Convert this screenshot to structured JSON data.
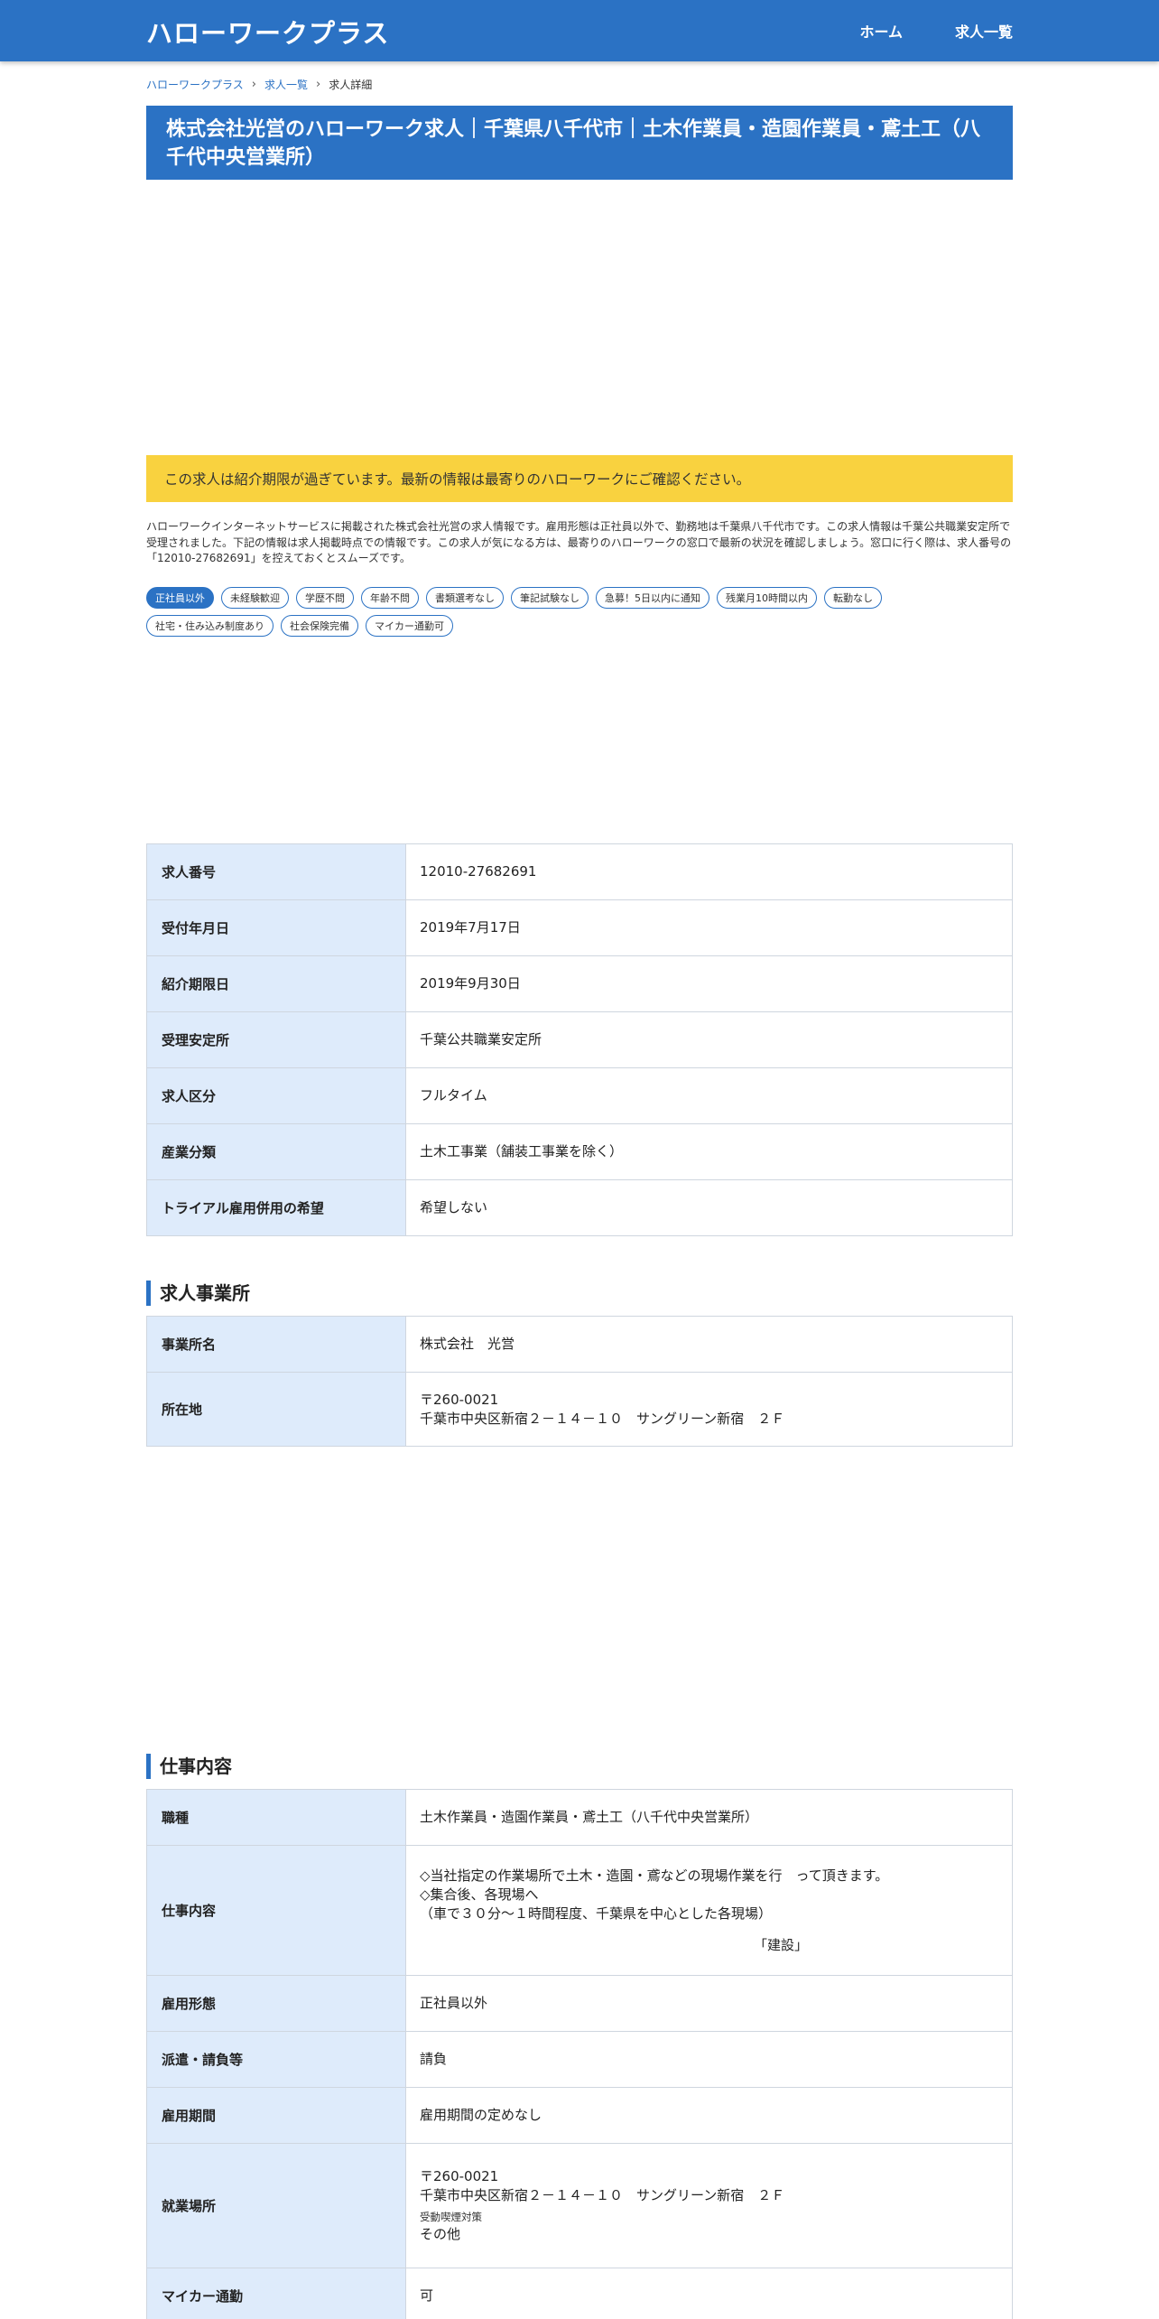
{
  "header": {
    "brand": "ハローワークプラス",
    "nav": [
      "ホーム",
      "求人一覧"
    ]
  },
  "breadcrumb": {
    "items": [
      "ハローワークプラス",
      "求人一覧"
    ],
    "current": "求人詳細"
  },
  "page_title": "株式会社光営のハローワーク求人｜千葉県八千代市｜土木作業員・造園作業員・鳶土工（八千代中央営業所）",
  "alert": "この求人は紹介期限が過ぎています。最新の情報は最寄りのハローワークにご確認ください。",
  "intro": "ハローワークインターネットサービスに掲載された株式会社光営の求人情報です。雇用形態は正社員以外で、勤務地は千葉県八千代市です。この求人情報は千葉公共職業安定所で受理されました。下記の情報は求人掲載時点での情報です。この求人が気になる方は、最寄りのハローワークの窓口で最新の状況を確認しましょう。窓口に行く際は、求人番号の「12010-27682691」を控えておくとスムーズです。",
  "tags": [
    {
      "label": "正社員以外",
      "active": true
    },
    {
      "label": "未経験歓迎",
      "active": false
    },
    {
      "label": "学歴不問",
      "active": false
    },
    {
      "label": "年齢不問",
      "active": false
    },
    {
      "label": "書類選考なし",
      "active": false
    },
    {
      "label": "筆記試験なし",
      "active": false
    },
    {
      "label": "急募！5日以内に通知",
      "active": false
    },
    {
      "label": "残業月10時間以内",
      "active": false
    },
    {
      "label": "転勤なし",
      "active": false
    },
    {
      "label": "社宅・住み込み制度あり",
      "active": false
    },
    {
      "label": "社会保険完備",
      "active": false
    },
    {
      "label": "マイカー通勤可",
      "active": false
    }
  ],
  "basic_info": [
    {
      "label": "求人番号",
      "value": "12010-27682691"
    },
    {
      "label": "受付年月日",
      "value": "2019年7月17日"
    },
    {
      "label": "紹介期限日",
      "value": "2019年9月30日"
    },
    {
      "label": "受理安定所",
      "value": "千葉公共職業安定所"
    },
    {
      "label": "求人区分",
      "value": "フルタイム"
    },
    {
      "label": "産業分類",
      "value": "土木工事業（舗装工事業を除く）"
    },
    {
      "label": "トライアル雇用併用の希望",
      "value": "希望しない"
    }
  ],
  "office": {
    "heading": "求人事業所",
    "name_label": "事業所名",
    "name_value": "株式会社　光営",
    "address_label": "所在地",
    "postal": "〒260-0021",
    "address": "千葉市中央区新宿２－１４－１０　サングリーン新宿　２Ｆ"
  },
  "job": {
    "heading": "仕事内容",
    "occupation_label": "職種",
    "occupation_value": "土木作業員・造園作業員・鳶土工（八千代中央営業所）",
    "content_label": "仕事内容",
    "content_line1": "◇当社指定の作業場所で土木・造園・鳶などの現場作業を行　って頂きます。",
    "content_line2": "◇集合後、各現場へ",
    "content_line3": "（車で３０分～１時間程度、千葉県を中心とした各現場）",
    "content_line4": "「建設」",
    "employment_label": "雇用形態",
    "employment_value": "正社員以外",
    "dispatch_label": "派遣・請負等",
    "dispatch_value": "請負",
    "period_label": "雇用期間",
    "period_value": "雇用期間の定めなし",
    "location_label": "就業場所",
    "location_postal": "〒260-0021",
    "location_address": "千葉市中央区新宿２－１４－１０　サングリーン新宿　２Ｆ",
    "smoking_label": "受動喫煙対策",
    "smoking_value": "その他",
    "car_label": "マイカー通勤",
    "car_value": "可"
  }
}
